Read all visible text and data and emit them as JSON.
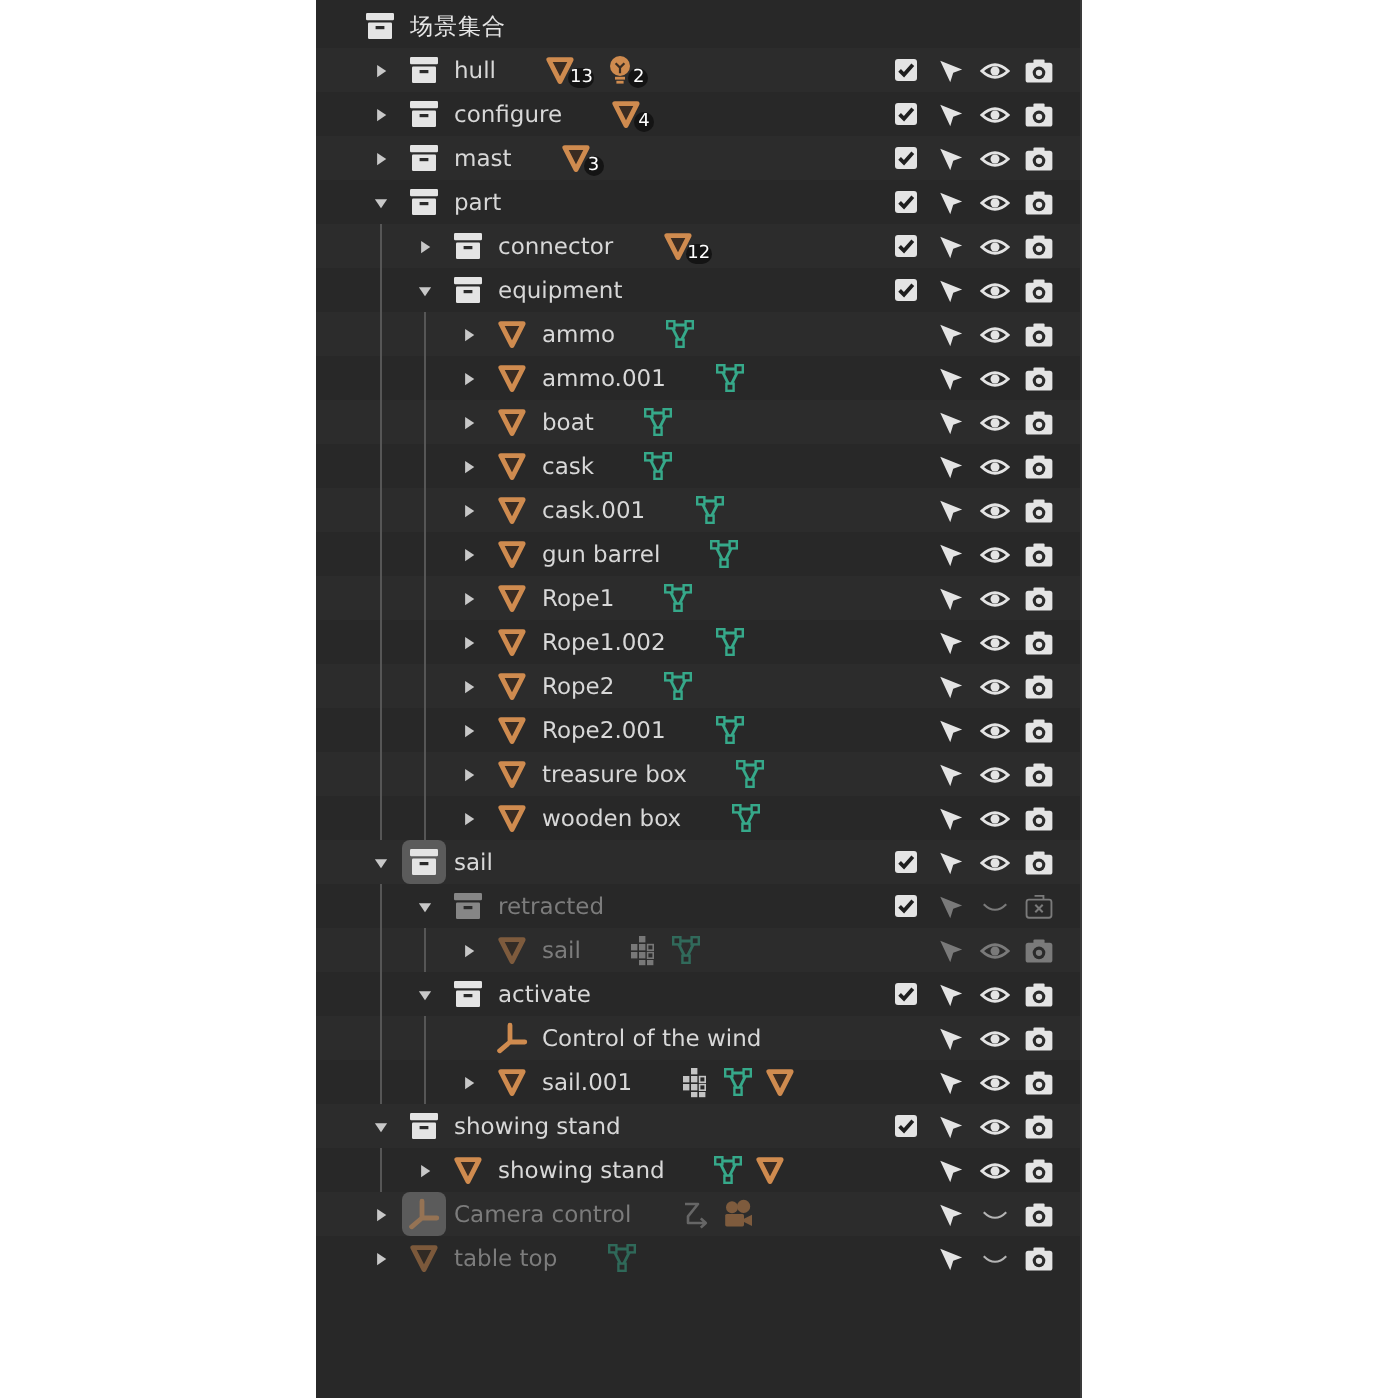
{
  "outliner": {
    "root": {
      "kind": "collection",
      "name": "场景集合",
      "active": false,
      "dimmed": false,
      "children": [
        {
          "kind": "collection",
          "name": "hull",
          "expanded": false,
          "active": false,
          "dimmed": false,
          "badges": [
            {
              "kind": "mesh",
              "count": "13"
            },
            {
              "kind": "light",
              "count": "2"
            }
          ],
          "checked": true,
          "restrictions_dimmed": false,
          "visible": true,
          "renderable": true
        },
        {
          "kind": "collection",
          "name": "configure",
          "expanded": false,
          "active": false,
          "dimmed": false,
          "badges": [
            {
              "kind": "mesh",
              "count": "4"
            }
          ],
          "checked": true,
          "restrictions_dimmed": false,
          "visible": true,
          "renderable": true
        },
        {
          "kind": "collection",
          "name": "mast",
          "expanded": false,
          "active": false,
          "dimmed": false,
          "badges": [
            {
              "kind": "mesh",
              "count": "3"
            }
          ],
          "checked": true,
          "restrictions_dimmed": false,
          "visible": true,
          "renderable": true
        },
        {
          "kind": "collection",
          "name": "part",
          "expanded": true,
          "active": false,
          "dimmed": false,
          "checked": true,
          "restrictions_dimmed": false,
          "visible": true,
          "renderable": true,
          "children": [
            {
              "kind": "collection",
              "name": "connector",
              "expanded": false,
              "active": false,
              "dimmed": false,
              "badges": [
                {
                  "kind": "mesh",
                  "count": "12"
                }
              ],
              "checked": true,
              "restrictions_dimmed": false,
              "visible": true,
              "renderable": true
            },
            {
              "kind": "collection",
              "name": "equipment",
              "expanded": true,
              "active": false,
              "dimmed": false,
              "checked": true,
              "restrictions_dimmed": false,
              "visible": true,
              "renderable": true,
              "children": [
                {
                  "kind": "mesh",
                  "name": "ammo",
                  "expanded": false,
                  "active": false,
                  "dimmed": false,
                  "badges": [
                    {
                      "kind": "mesh_data"
                    }
                  ],
                  "restrictions_dimmed": false,
                  "visible": true,
                  "renderable": true
                },
                {
                  "kind": "mesh",
                  "name": "ammo.001",
                  "expanded": false,
                  "active": false,
                  "dimmed": false,
                  "badges": [
                    {
                      "kind": "mesh_data"
                    }
                  ],
                  "restrictions_dimmed": false,
                  "visible": true,
                  "renderable": true
                },
                {
                  "kind": "mesh",
                  "name": "boat",
                  "expanded": false,
                  "active": false,
                  "dimmed": false,
                  "badges": [
                    {
                      "kind": "mesh_data"
                    }
                  ],
                  "restrictions_dimmed": false,
                  "visible": true,
                  "renderable": true
                },
                {
                  "kind": "mesh",
                  "name": "cask",
                  "expanded": false,
                  "active": false,
                  "dimmed": false,
                  "badges": [
                    {
                      "kind": "mesh_data"
                    }
                  ],
                  "restrictions_dimmed": false,
                  "visible": true,
                  "renderable": true
                },
                {
                  "kind": "mesh",
                  "name": "cask.001",
                  "expanded": false,
                  "active": false,
                  "dimmed": false,
                  "badges": [
                    {
                      "kind": "mesh_data"
                    }
                  ],
                  "restrictions_dimmed": false,
                  "visible": true,
                  "renderable": true
                },
                {
                  "kind": "mesh",
                  "name": "gun barrel",
                  "expanded": false,
                  "active": false,
                  "dimmed": false,
                  "badges": [
                    {
                      "kind": "mesh_data"
                    }
                  ],
                  "restrictions_dimmed": false,
                  "visible": true,
                  "renderable": true
                },
                {
                  "kind": "mesh",
                  "name": "Rope1",
                  "expanded": false,
                  "active": false,
                  "dimmed": false,
                  "badges": [
                    {
                      "kind": "mesh_data"
                    }
                  ],
                  "restrictions_dimmed": false,
                  "visible": true,
                  "renderable": true
                },
                {
                  "kind": "mesh",
                  "name": "Rope1.002",
                  "expanded": false,
                  "active": false,
                  "dimmed": false,
                  "badges": [
                    {
                      "kind": "mesh_data"
                    }
                  ],
                  "restrictions_dimmed": false,
                  "visible": true,
                  "renderable": true
                },
                {
                  "kind": "mesh",
                  "name": "Rope2",
                  "expanded": false,
                  "active": false,
                  "dimmed": false,
                  "badges": [
                    {
                      "kind": "mesh_data"
                    }
                  ],
                  "restrictions_dimmed": false,
                  "visible": true,
                  "renderable": true
                },
                {
                  "kind": "mesh",
                  "name": "Rope2.001",
                  "expanded": false,
                  "active": false,
                  "dimmed": false,
                  "badges": [
                    {
                      "kind": "mesh_data"
                    }
                  ],
                  "restrictions_dimmed": false,
                  "visible": true,
                  "renderable": true
                },
                {
                  "kind": "mesh",
                  "name": "treasure box",
                  "expanded": false,
                  "active": false,
                  "dimmed": false,
                  "badges": [
                    {
                      "kind": "mesh_data"
                    }
                  ],
                  "restrictions_dimmed": false,
                  "visible": true,
                  "renderable": true
                },
                {
                  "kind": "mesh",
                  "name": "wooden box",
                  "expanded": false,
                  "active": false,
                  "dimmed": false,
                  "badges": [
                    {
                      "kind": "mesh_data"
                    }
                  ],
                  "restrictions_dimmed": false,
                  "visible": true,
                  "renderable": true
                }
              ]
            }
          ]
        },
        {
          "kind": "collection",
          "name": "sail",
          "expanded": true,
          "active": true,
          "dimmed": false,
          "checked": true,
          "restrictions_dimmed": false,
          "visible": true,
          "renderable": true,
          "children": [
            {
              "kind": "collection",
              "name": "retracted",
              "expanded": true,
              "active": false,
              "dimmed": true,
              "checked": true,
              "restrictions_dimmed": true,
              "visible": false,
              "renderable": false,
              "children": [
                {
                  "kind": "mesh",
                  "name": "sail",
                  "expanded": false,
                  "active": false,
                  "dimmed": true,
                  "badges": [
                    {
                      "kind": "grid"
                    },
                    {
                      "kind": "mesh_data"
                    }
                  ],
                  "restrictions_dimmed": true,
                  "visible": true,
                  "renderable": true
                }
              ]
            },
            {
              "kind": "collection",
              "name": "activate",
              "expanded": true,
              "active": false,
              "dimmed": false,
              "checked": true,
              "restrictions_dimmed": false,
              "visible": true,
              "renderable": true,
              "children": [
                {
                  "kind": "empty",
                  "name": "Control of the wind",
                  "active": false,
                  "dimmed": false,
                  "restrictions_dimmed": false,
                  "visible": true,
                  "renderable": true
                },
                {
                  "kind": "mesh",
                  "name": "sail.001",
                  "expanded": false,
                  "active": false,
                  "dimmed": false,
                  "badges": [
                    {
                      "kind": "grid"
                    },
                    {
                      "kind": "mesh_data"
                    },
                    {
                      "kind": "mesh"
                    }
                  ],
                  "restrictions_dimmed": false,
                  "visible": true,
                  "renderable": true
                }
              ]
            }
          ]
        },
        {
          "kind": "collection",
          "name": "showing stand",
          "expanded": true,
          "active": false,
          "dimmed": false,
          "checked": true,
          "restrictions_dimmed": false,
          "visible": true,
          "renderable": true,
          "children": [
            {
              "kind": "mesh",
              "name": "showing stand",
              "expanded": false,
              "active": false,
              "dimmed": false,
              "badges": [
                {
                  "kind": "mesh_data"
                },
                {
                  "kind": "mesh"
                }
              ],
              "restrictions_dimmed": false,
              "visible": true,
              "renderable": true
            }
          ]
        },
        {
          "kind": "empty",
          "name": "Camera control",
          "expanded": false,
          "active": true,
          "dimmed": true,
          "badges": [
            {
              "kind": "path"
            },
            {
              "kind": "camera"
            }
          ],
          "restrictions_dimmed": false,
          "visible": false,
          "renderable": true
        },
        {
          "kind": "mesh",
          "name": "table top",
          "expanded": false,
          "active": false,
          "dimmed": true,
          "badges": [
            {
              "kind": "mesh_data"
            }
          ],
          "restrictions_dimmed": false,
          "visible": false,
          "renderable": true
        }
      ]
    }
  }
}
